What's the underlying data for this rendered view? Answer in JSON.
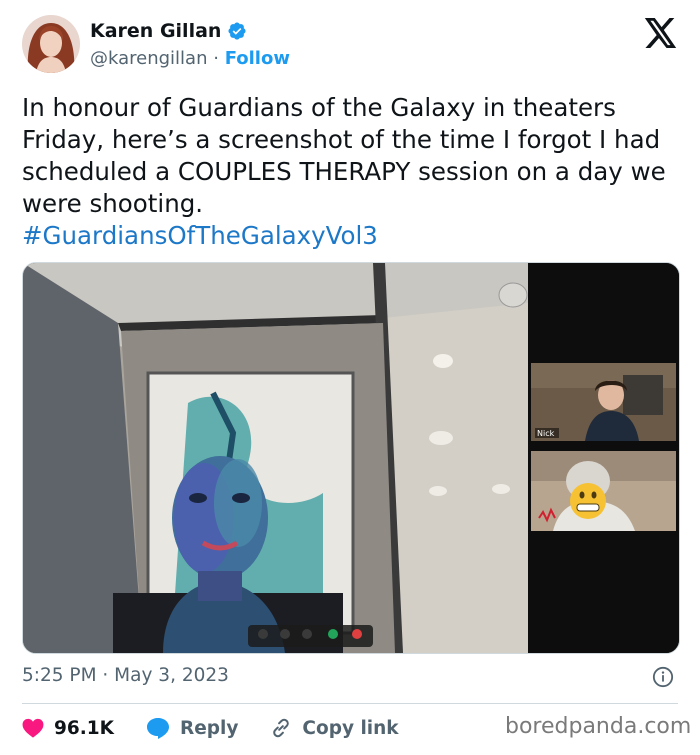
{
  "author": {
    "display_name": "Karen Gillan",
    "handle": "@karengillan",
    "separator": "·",
    "follow_label": "Follow",
    "verified": true
  },
  "tweet": {
    "text": "In honour of Guardians of the Galaxy in theaters Friday, here’s a screenshot of the time I forgot I had scheduled a COUPLES THERAPY session on a day we were shooting.",
    "hashtag": "#GuardiansOfTheGalaxyVol3"
  },
  "media": {
    "participants": [
      {
        "name_tag": "Nick"
      }
    ],
    "call_controls": [
      "Mute mic",
      "Stop video",
      "Chat",
      "Share",
      "End"
    ]
  },
  "meta": {
    "timestamp": "5:25 PM · May 3, 2023"
  },
  "actions": {
    "like_count": "96.1K",
    "reply_label": "Reply",
    "copy_label": "Copy link"
  },
  "watermark": "boredpanda.com",
  "colors": {
    "accent": "#1d9bf0",
    "like": "#f91880",
    "text": "#0f1419",
    "muted": "#536471"
  },
  "icons": [
    "verified-badge-icon",
    "x-logo-icon",
    "info-icon",
    "heart-icon",
    "reply-bubble-icon",
    "link-icon"
  ]
}
